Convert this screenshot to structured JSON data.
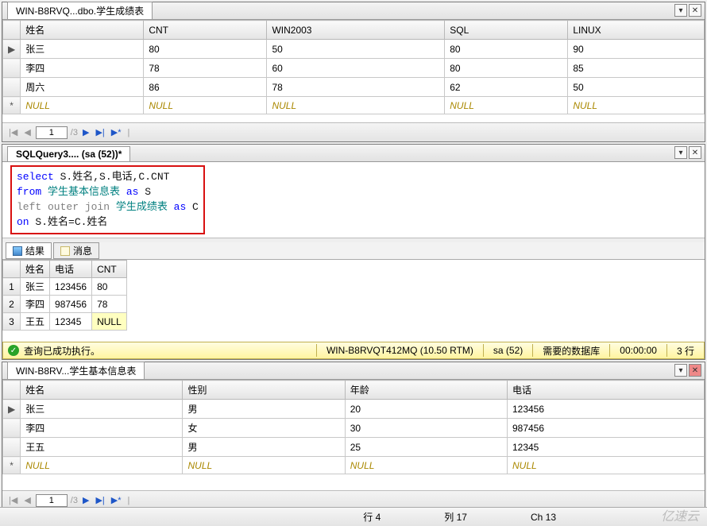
{
  "pane1": {
    "tab_title": "WIN-B8RVQ...dbo.学生成绩表",
    "columns": [
      "姓名",
      "CNT",
      "WIN2003",
      "SQL",
      "LINUX"
    ],
    "rows": [
      [
        "张三",
        "80",
        "50",
        "80",
        "90"
      ],
      [
        "李四",
        "78",
        "60",
        "80",
        "85"
      ],
      [
        "周六",
        "86",
        "78",
        "62",
        "50"
      ]
    ],
    "null_label": "NULL",
    "nav_page": "1",
    "nav_total": "/3"
  },
  "sql_pane": {
    "tab_title": "SQLQuery3.... (sa (52))*",
    "line1_a": "select",
    "line1_b": " S.姓名,S.电话,C.CNT",
    "line2_a": "from",
    "line2_b": " 学生基本信息表 ",
    "line2_c": "as",
    "line2_d": " S",
    "line3_a": "left outer join",
    "line3_b": " 学生成绩表 ",
    "line3_c": "as",
    "line3_d": " C",
    "line4_a": "on",
    "line4_b": " S.姓名=C.姓名"
  },
  "results": {
    "tab_results": "结果",
    "tab_messages": "消息",
    "columns": [
      "姓名",
      "电话",
      "CNT"
    ],
    "rows": [
      [
        "张三",
        "123456",
        "80"
      ],
      [
        "李四",
        "987456",
        "78"
      ],
      [
        "王五",
        "12345",
        "NULL"
      ]
    ]
  },
  "status": {
    "success": "查询已成功执行。",
    "server": "WIN-B8RVQT412MQ (10.50 RTM)",
    "user": "sa (52)",
    "db": "需要的数据库",
    "time": "00:00:00",
    "rows": "3 行"
  },
  "pane2": {
    "tab_title": "WIN-B8RV...学生基本信息表",
    "columns": [
      "姓名",
      "性别",
      "年龄",
      "电话"
    ],
    "rows": [
      [
        "张三",
        "男",
        "20",
        "123456"
      ],
      [
        "李四",
        "女",
        "30",
        "987456"
      ],
      [
        "王五",
        "男",
        "25",
        "12345"
      ]
    ],
    "null_label": "NULL",
    "nav_page": "1",
    "nav_total": "/3"
  },
  "bottom": {
    "line": "行 4",
    "col": "列 17",
    "ch": "Ch 13"
  },
  "watermark": "亿速云",
  "icons": {
    "pin": "▾",
    "close": "✕",
    "first": "|◀",
    "prev": "◀",
    "next": "▶",
    "last": "▶|",
    "newrec": "▶*",
    "play": "▶"
  }
}
